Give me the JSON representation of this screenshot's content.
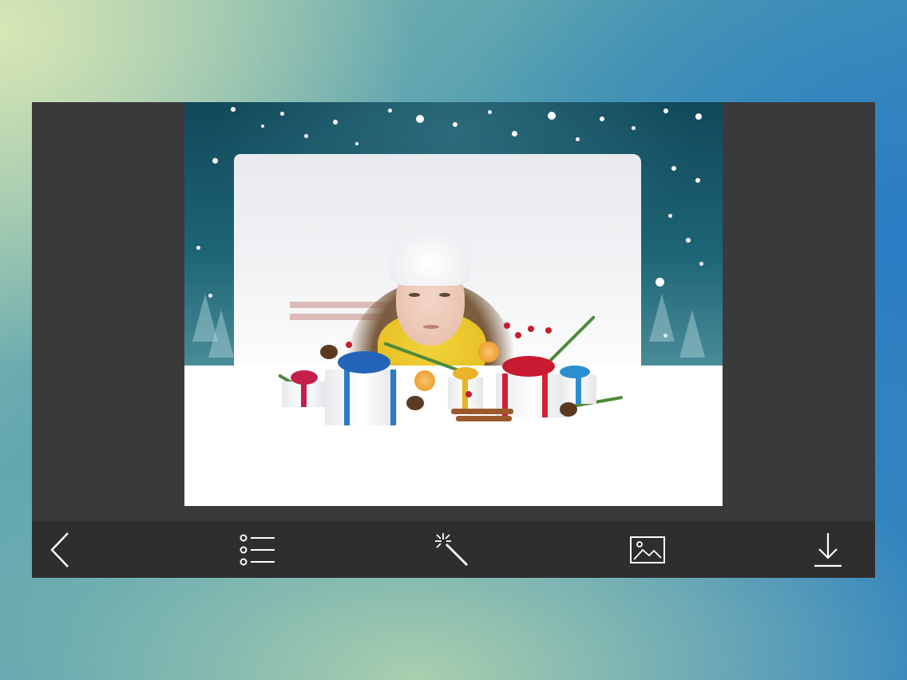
{
  "app": {
    "window": "photo-frame-editor",
    "frame_theme": "christmas-snow"
  },
  "toolbar": {
    "buttons": [
      {
        "id": "back",
        "icon": "chevron-left-icon"
      },
      {
        "id": "frames-list",
        "icon": "list-icon"
      },
      {
        "id": "effects",
        "icon": "magic-wand-icon"
      },
      {
        "id": "gallery",
        "icon": "image-icon"
      },
      {
        "id": "save",
        "icon": "download-icon"
      }
    ]
  },
  "colors": {
    "app_background": "#3a3a3c",
    "toolbar_background": "#2e2e30",
    "icon_color": "#ffffff",
    "frame_sky": "#1d6575"
  }
}
